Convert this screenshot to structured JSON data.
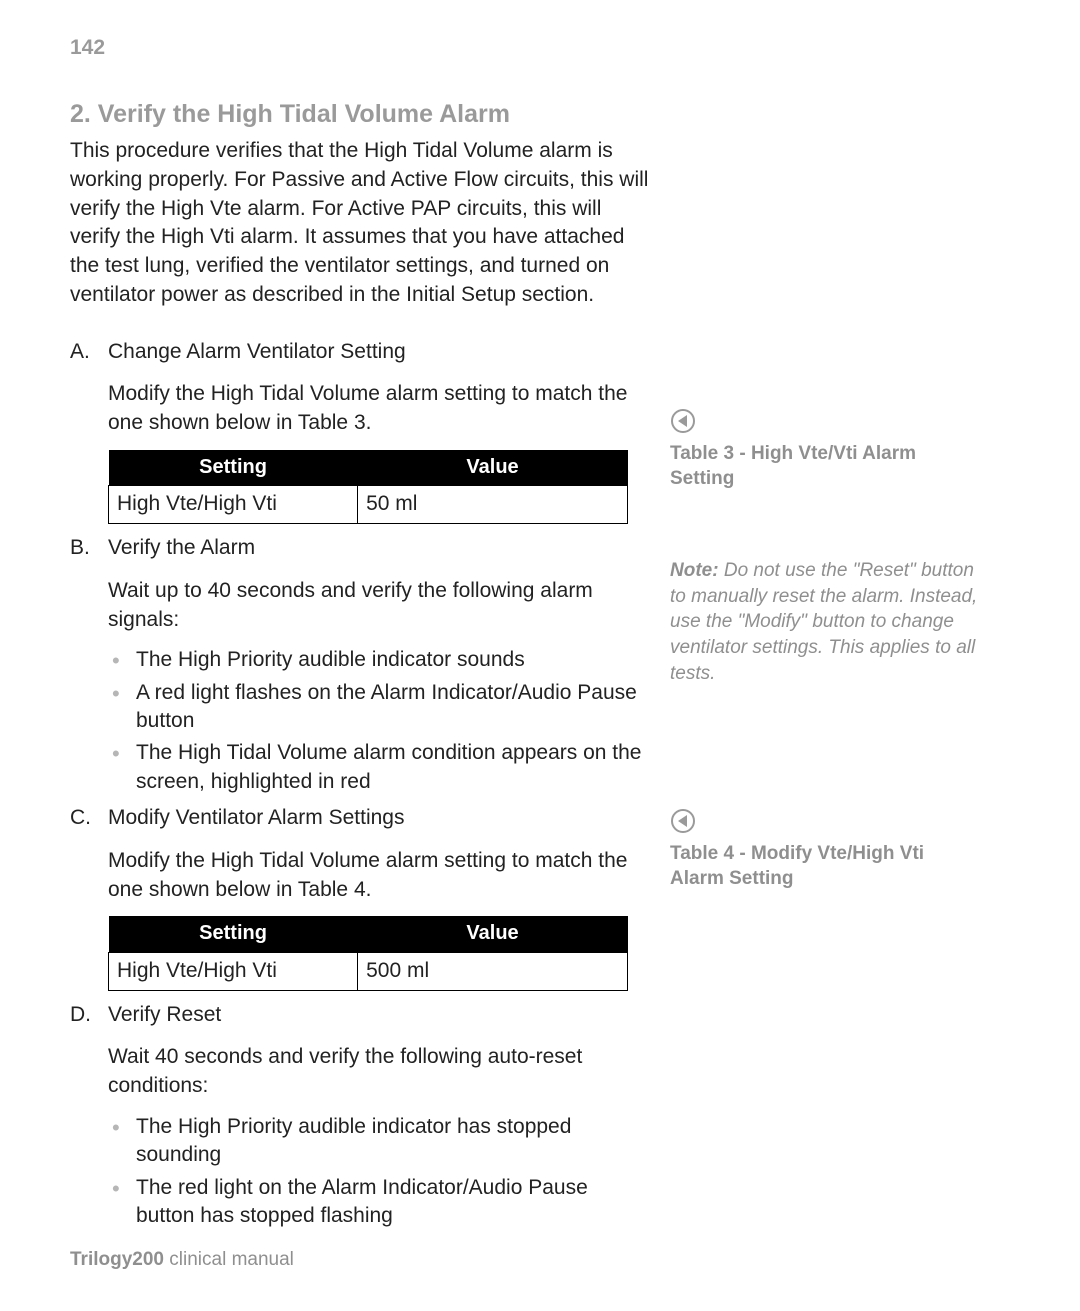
{
  "page_number": "142",
  "heading": "2.  Verify the High Tidal Volume Alarm",
  "intro": "This procedure verifies that the High Tidal Volume alarm is working properly.  For Passive and Active Flow circuits, this will verify the High Vte alarm. For Active PAP circuits, this will verify the High Vti alarm. It assumes that you have attached the test lung, verified the ventilator settings, and turned on ventilator power as described in the Initial Setup section.",
  "steps": {
    "a": {
      "lead": "A.",
      "title": "Change Alarm Ventilator Setting",
      "body": "Modify the High Tidal Volume alarm setting to match the one shown below in Table 3."
    },
    "b": {
      "lead": "B.",
      "title": "Verify the Alarm",
      "body": "Wait up to 40 seconds and verify the following alarm signals:",
      "bullets": [
        "The High Priority audible indicator sounds",
        "A red light flashes on the Alarm Indicator/Audio Pause button",
        "The High Tidal Volume alarm condition appears on the screen, highlighted in red"
      ]
    },
    "c": {
      "lead": "C.",
      "title": "Modify Ventilator Alarm Settings",
      "body": "Modify the High Tidal Volume alarm setting to match the one shown below in Table 4."
    },
    "d": {
      "lead": "D.",
      "title": "Verify Reset",
      "body": "Wait 40 seconds and verify the following auto-reset conditions:",
      "bullets": [
        "The High Priority audible indicator has stopped sounding",
        "The red light on the Alarm Indicator/Audio Pause button has stopped flashing"
      ]
    }
  },
  "table_headers": {
    "setting": "Setting",
    "value": "Value"
  },
  "table3": {
    "rows": [
      {
        "setting": "High Vte/High Vti",
        "value": "50 ml"
      }
    ],
    "caption": "Table 3 - High Vte/Vti Alarm Setting"
  },
  "table4": {
    "rows": [
      {
        "setting": "High Vte/High Vti",
        "value": "500 ml"
      }
    ],
    "caption": "Table 4 - Modify Vte/High Vti Alarm Setting"
  },
  "side_note": {
    "label": "Note:",
    "text": "Do not use the \"Reset\" button to manually reset the alarm.  Instead, use the \"Modify\" button to change ventilator settings.  This applies to all tests."
  },
  "footer": {
    "product": "Trilogy200",
    "doc": " clinical manual"
  }
}
